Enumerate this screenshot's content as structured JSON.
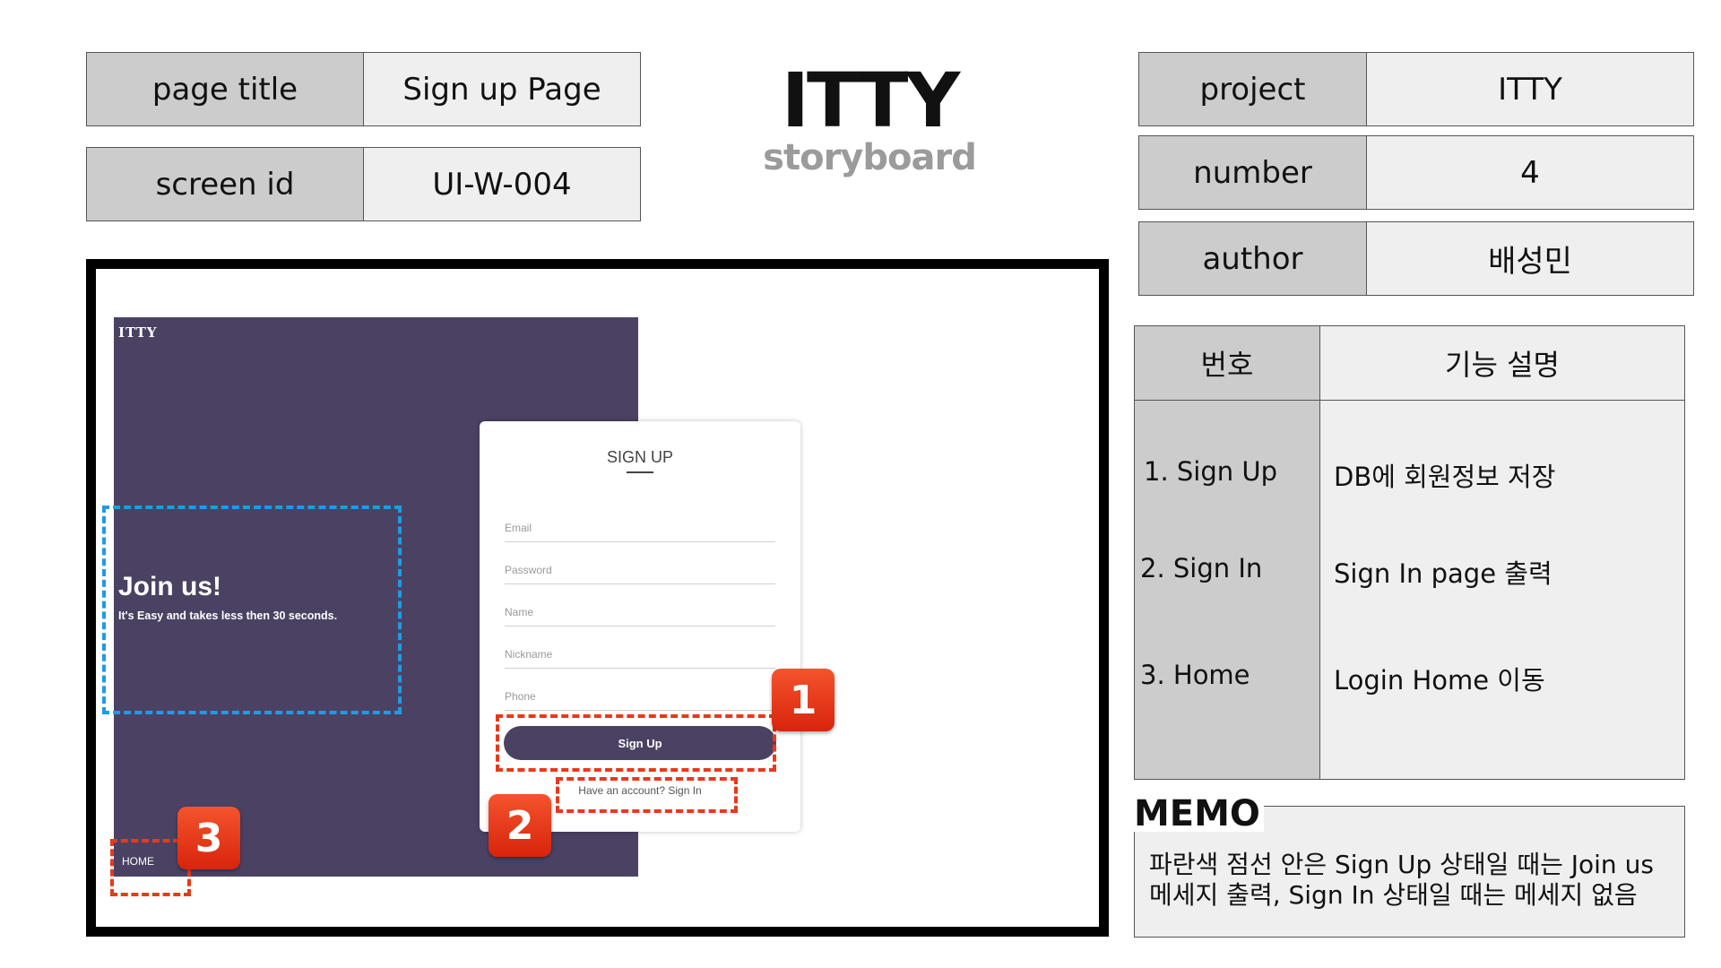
{
  "meta": {
    "page_title_label": "page title",
    "page_title_value": "Sign up Page",
    "screen_id_label": "screen id",
    "screen_id_value": "UI-W-004",
    "project_label": "project",
    "project_value": "ITTY",
    "number_label": "number",
    "number_value": "4",
    "author_label": "author",
    "author_value": "배성민"
  },
  "logo": {
    "title": "ITTY",
    "subtitle": "storyboard"
  },
  "mockup": {
    "app_logo": "ITTY",
    "join_title": "Join us!",
    "join_subtitle": "It's Easy and takes less then 30 seconds.",
    "home_link": "HOME",
    "card": {
      "title": "SIGN UP",
      "fields": [
        "Email",
        "Password",
        "Name",
        "Nickname",
        "Phone"
      ],
      "signup_button": "Sign Up",
      "signin_link": "Have an account? Sign In"
    },
    "badges": [
      "1",
      "2",
      "3"
    ],
    "colors": {
      "panel": "#4b4263",
      "blue_dash": "#1e9be5",
      "red_dash": "#e8391c",
      "badge": "#e8391c"
    }
  },
  "description": {
    "header_no": "번호",
    "header_desc": "기능 설명",
    "items": [
      {
        "no": "1. Sign Up",
        "desc": "DB에 회원정보 저장"
      },
      {
        "no": "2. Sign In",
        "desc": "Sign In page 출력"
      },
      {
        "no": "3. Home",
        "desc": "Login Home 이동"
      }
    ]
  },
  "memo": {
    "label": "MEMO",
    "lines": [
      "파란색 점선 안은 Sign Up 상태일 때는 Join us",
      "메세지 출력, Sign In 상태일 때는 메세지 없음"
    ]
  }
}
